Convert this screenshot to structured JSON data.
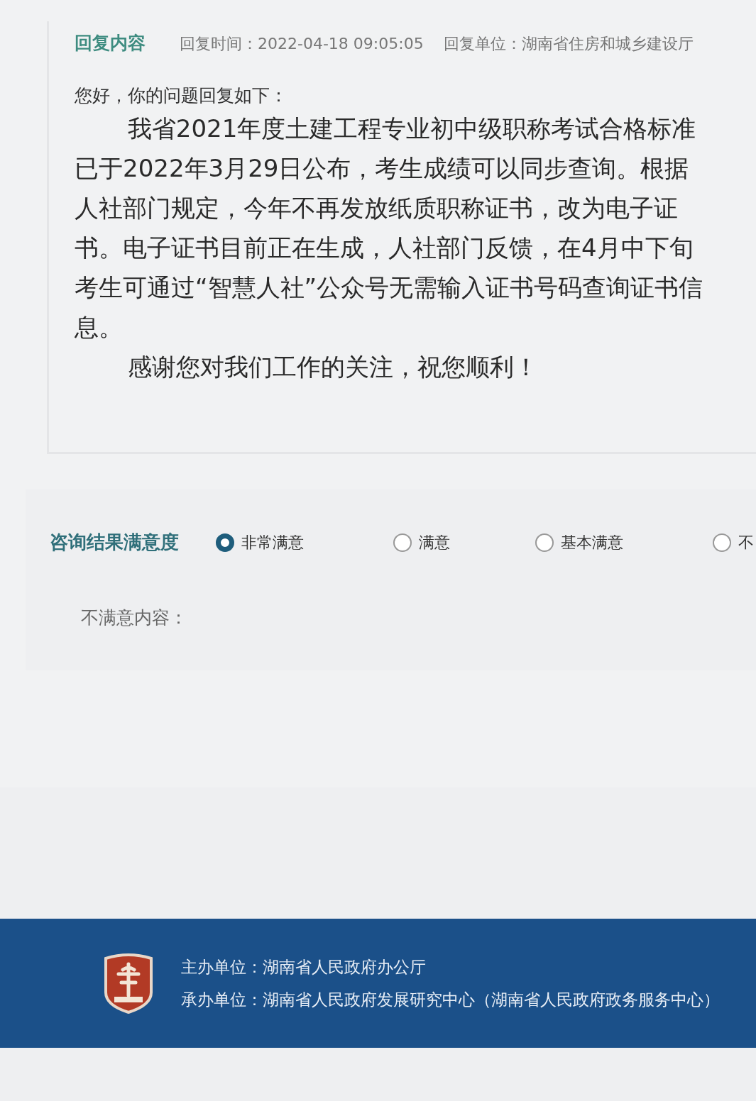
{
  "reply": {
    "heading": "回复内容",
    "time_label": "回复时间：",
    "time": "2022-04-18 09:05:05",
    "unit_label": "回复单位：",
    "unit": "湖南省住房和城乡建设厅",
    "greeting": "您好，你的问题回复如下：",
    "paragraphs": [
      "我省2021年度土建工程专业初中级职称考试合格标准已于2022年3月29日公布，考生成绩可以同步查询。根据人社部门规定，今年不再发放纸质职称证书，改为电子证书。电子证书目前正在生成，人社部门反馈，在4月中下旬考生可通过“智慧人社”公众号无需输入证书号码查询证书信息。",
      "感谢您对我们工作的关注，祝您顺利！"
    ]
  },
  "satisfaction": {
    "label": "咨询结果满意度",
    "options": [
      {
        "label": "非常满意",
        "selected": true
      },
      {
        "label": "满意",
        "selected": false
      },
      {
        "label": "基本满意",
        "selected": false
      },
      {
        "label": "不",
        "selected": false
      }
    ],
    "complaint_label": "不满意内容："
  },
  "footer": {
    "lines": [
      {
        "label": "主办单位：",
        "value": "湖南省人民政府办公厅"
      },
      {
        "label": "承办单位：",
        "value": "湖南省人民政府发展研究中心（湖南省人民政府政务服务中心）"
      }
    ]
  }
}
